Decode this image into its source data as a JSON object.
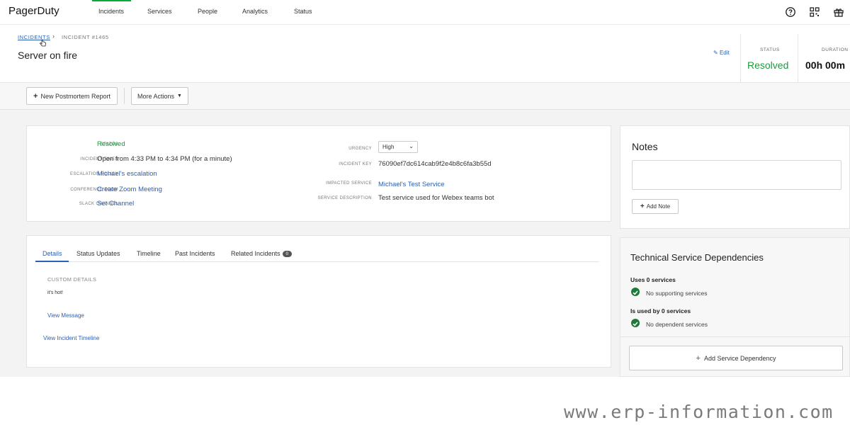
{
  "app": {
    "logo": "PagerDuty"
  },
  "nav": {
    "items": [
      "Incidents",
      "Services",
      "People",
      "Analytics",
      "Status"
    ],
    "active": "Incidents",
    "icons": [
      "help-icon",
      "apps-grid-icon",
      "gift-icon"
    ]
  },
  "breadcrumb": {
    "root": "INCIDENTS",
    "current": "INCIDENT #1465"
  },
  "incident": {
    "title": "Server on fire",
    "edit_label": "Edit",
    "status_label": "STATUS",
    "status_value": "Resolved",
    "duration_label": "DURATION",
    "duration_value": "00h 00m"
  },
  "toolbar": {
    "postmortem_label": "New Postmortem Report",
    "more_actions_label": "More Actions"
  },
  "details": {
    "left": [
      {
        "label": "STATUS",
        "value": "Resolved",
        "style": "green"
      },
      {
        "label": "INCIDENT TIMES",
        "value": "Open from 4:33 PM to 4:34 PM (for a minute)",
        "style": "plain"
      },
      {
        "label": "ESCALATION POLICY",
        "value": "Michael's escalation",
        "style": "link"
      },
      {
        "label": "CONFERENCE ZOOM",
        "value": "Create Zoom Meeting",
        "style": "link"
      },
      {
        "label": "SLACK CHANNEL",
        "value": "Set Channel",
        "style": "link"
      }
    ],
    "right": {
      "urgency_label": "URGENCY",
      "urgency_value": "High",
      "incident_key_label": "INCIDENT KEY",
      "incident_key_value": "76090ef7dc614cab9f2e4b8c6fa3b55d",
      "impacted_service_label": "IMPACTED SERVICE",
      "impacted_service_value": "Michael's Test Service",
      "service_description_label": "SERVICE DESCRIPTION",
      "service_description_value": "Test service used for Webex teams bot"
    }
  },
  "tabs": {
    "items": [
      "Details",
      "Status Updates",
      "Timeline",
      "Past Incidents",
      "Related Incidents"
    ],
    "active": "Details",
    "related_count": "0"
  },
  "custom_details": {
    "heading": "CUSTOM DETAILS",
    "text": "it's hot!",
    "view_message": "View Message",
    "view_timeline": "View Incident Timeline"
  },
  "notes": {
    "title": "Notes",
    "add_note_label": "Add Note"
  },
  "dependencies": {
    "title": "Technical Service Dependencies",
    "uses_heading": "Uses 0 services",
    "uses_item": "No supporting services",
    "used_by_heading": "Is used by 0 services",
    "used_by_item": "No dependent services",
    "add_label": "Add Service Dependency"
  },
  "watermark": "www.erp-information.com",
  "colors": {
    "brand_green": "#06ac38",
    "resolved_green": "#1c9b3e",
    "link_blue": "#2b5fb3",
    "check_green": "#1f7a3a"
  }
}
